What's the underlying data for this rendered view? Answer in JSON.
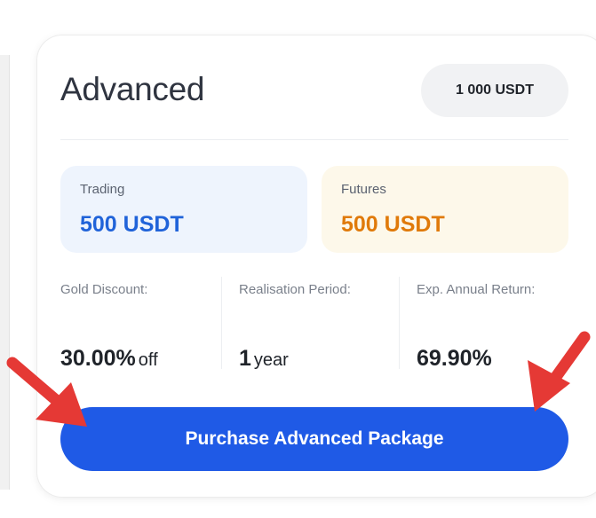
{
  "package": {
    "name": "Advanced",
    "price": "1 000 USDT"
  },
  "allocations": [
    {
      "label": "Trading",
      "value": "500 USDT",
      "color": "#2063d9"
    },
    {
      "label": "Futures",
      "value": "500 USDT",
      "color": "#e07a0a"
    }
  ],
  "stats": [
    {
      "label": "Gold Discount:",
      "value": "30.00%",
      "unit": "off"
    },
    {
      "label": "Realisation Period:",
      "value": "1",
      "unit": "year"
    },
    {
      "label": "Exp. Annual Return:",
      "value": "69.90%",
      "unit": ""
    }
  ],
  "cta": {
    "label": "Purchase Advanced Package",
    "color": "#1f5ae6"
  },
  "annotations": {
    "arrow_color": "#e53935",
    "arrow_count": 2
  }
}
